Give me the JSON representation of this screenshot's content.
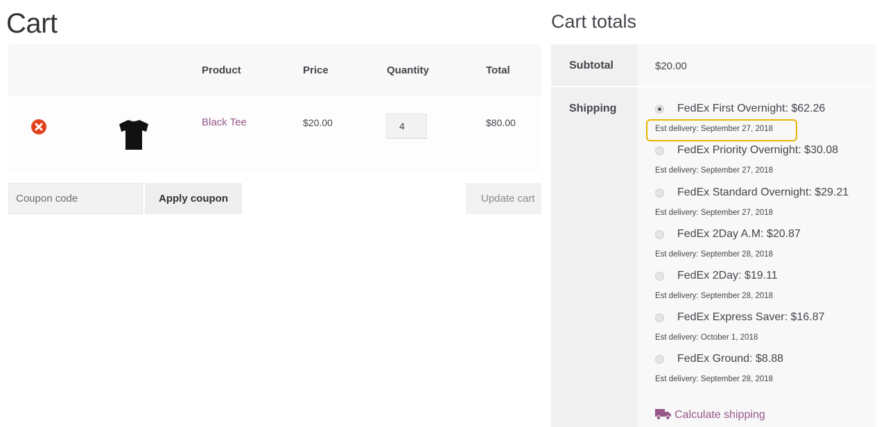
{
  "cart": {
    "title": "Cart",
    "headers": {
      "product": "Product",
      "price": "Price",
      "quantity": "Quantity",
      "total": "Total"
    },
    "items": [
      {
        "name": "Black Tee",
        "price": "$20.00",
        "quantity": "4",
        "total": "$80.00",
        "remove_icon": "remove-icon",
        "thumbnail_icon": "tshirt-icon"
      }
    ],
    "coupon_placeholder": "Coupon code",
    "apply_coupon_label": "Apply coupon",
    "update_cart_label": "Update cart"
  },
  "totals": {
    "title": "Cart totals",
    "subtotal_label": "Subtotal",
    "subtotal_value": "$20.00",
    "shipping_label": "Shipping",
    "shipping_options": [
      {
        "label": "FedEx First Overnight: $62.26",
        "est": "Est delivery: September 27, 2018",
        "selected": true
      },
      {
        "label": "FedEx Priority Overnight: $30.08",
        "est": "Est delivery: September 27, 2018",
        "selected": false
      },
      {
        "label": "FedEx Standard Overnight: $29.21",
        "est": "Est delivery: September 27, 2018",
        "selected": false
      },
      {
        "label": "FedEx 2Day A.M: $20.87",
        "est": "Est delivery: September 28, 2018",
        "selected": false
      },
      {
        "label": "FedEx 2Day: $19.11",
        "est": "Est delivery: September 28, 2018",
        "selected": false
      },
      {
        "label": "FedEx Express Saver: $16.87",
        "est": "Est delivery: October 1, 2018",
        "selected": false
      },
      {
        "label": "FedEx Ground: $8.88",
        "est": "Est delivery: September 28, 2018",
        "selected": false
      }
    ],
    "calculate_shipping_label": "Calculate shipping",
    "calculate_icon": "truck-icon"
  },
  "colors": {
    "link": "#96588a",
    "remove": "#e2401c",
    "highlight": "#e8b500"
  }
}
